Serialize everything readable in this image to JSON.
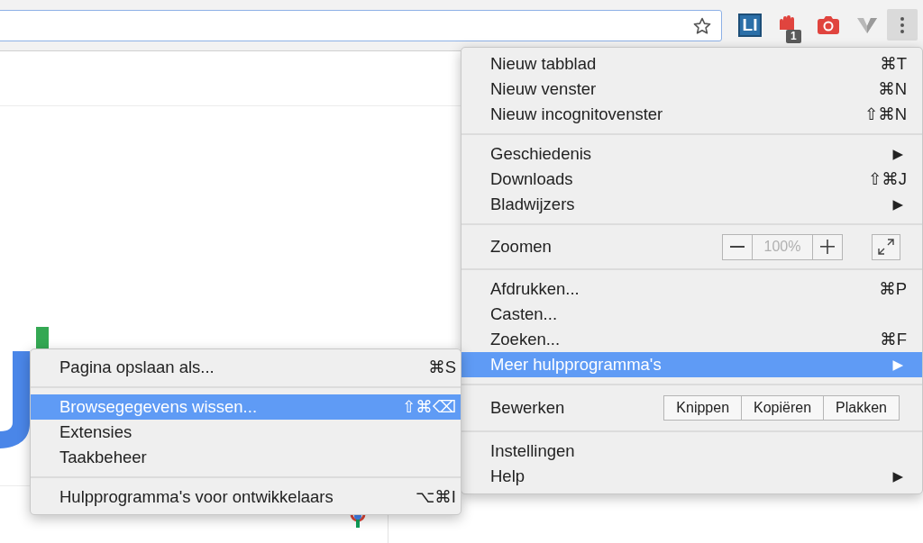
{
  "toolbar": {
    "extensions": [
      {
        "kind": "li",
        "text": "LI"
      },
      {
        "kind": "hand",
        "badge": "1"
      },
      {
        "kind": "camera"
      },
      {
        "kind": "v"
      }
    ],
    "menu_button": {
      "pressed": true
    }
  },
  "menu": {
    "groups": [
      {
        "items": [
          {
            "kind": "item",
            "label": "Nieuw tabblad",
            "shortcut": "⌘T",
            "selected": false
          },
          {
            "kind": "item",
            "label": "Nieuw venster",
            "shortcut": "⌘N",
            "selected": false
          },
          {
            "kind": "item",
            "label": "Nieuw incognitovenster",
            "shortcut": "⇧⌘N",
            "selected": false
          }
        ]
      },
      {
        "items": [
          {
            "kind": "item",
            "label": "Geschiedenis",
            "arrow": "▶",
            "selected": false
          },
          {
            "kind": "item",
            "label": "Downloads",
            "shortcut": "⇧⌘J",
            "selected": false
          },
          {
            "kind": "item",
            "label": "Bladwijzers",
            "arrow": "▶",
            "selected": false
          }
        ]
      },
      {
        "items": [
          {
            "kind": "zoom",
            "label": "Zoomen",
            "value": "100%"
          }
        ]
      },
      {
        "items": [
          {
            "kind": "item",
            "label": "Afdrukken...",
            "shortcut": "⌘P",
            "selected": false
          },
          {
            "kind": "item",
            "label": "Casten...",
            "selected": false
          },
          {
            "kind": "item",
            "label": "Zoeken...",
            "shortcut": "⌘F",
            "selected": false
          },
          {
            "kind": "item",
            "label": "Meer hulpprogramma's",
            "arrow": "▶",
            "selected": true
          }
        ]
      },
      {
        "items": [
          {
            "kind": "edit",
            "label": "Bewerken",
            "buttons": [
              "Knippen",
              "Kopiëren",
              "Plakken"
            ]
          }
        ]
      },
      {
        "items": [
          {
            "kind": "item",
            "label": "Instellingen",
            "selected": false
          },
          {
            "kind": "item",
            "label": "Help",
            "arrow": "▶",
            "selected": false
          }
        ]
      }
    ]
  },
  "submenu": {
    "groups": [
      {
        "items": [
          {
            "kind": "item",
            "label": "Pagina opslaan als...",
            "shortcut": "⌘S",
            "selected": false
          }
        ]
      },
      {
        "items": [
          {
            "kind": "item",
            "label": "Browsegegevens wissen...",
            "shortcut": "⇧⌘⌫",
            "selected": true
          },
          {
            "kind": "item",
            "label": "Extensies",
            "selected": false
          },
          {
            "kind": "item",
            "label": "Taakbeheer",
            "selected": false
          }
        ]
      },
      {
        "items": [
          {
            "kind": "item",
            "label": "Hulpprogramma's voor ontwikkelaars",
            "shortcut": "⌥⌘I",
            "selected": false
          }
        ]
      }
    ]
  }
}
